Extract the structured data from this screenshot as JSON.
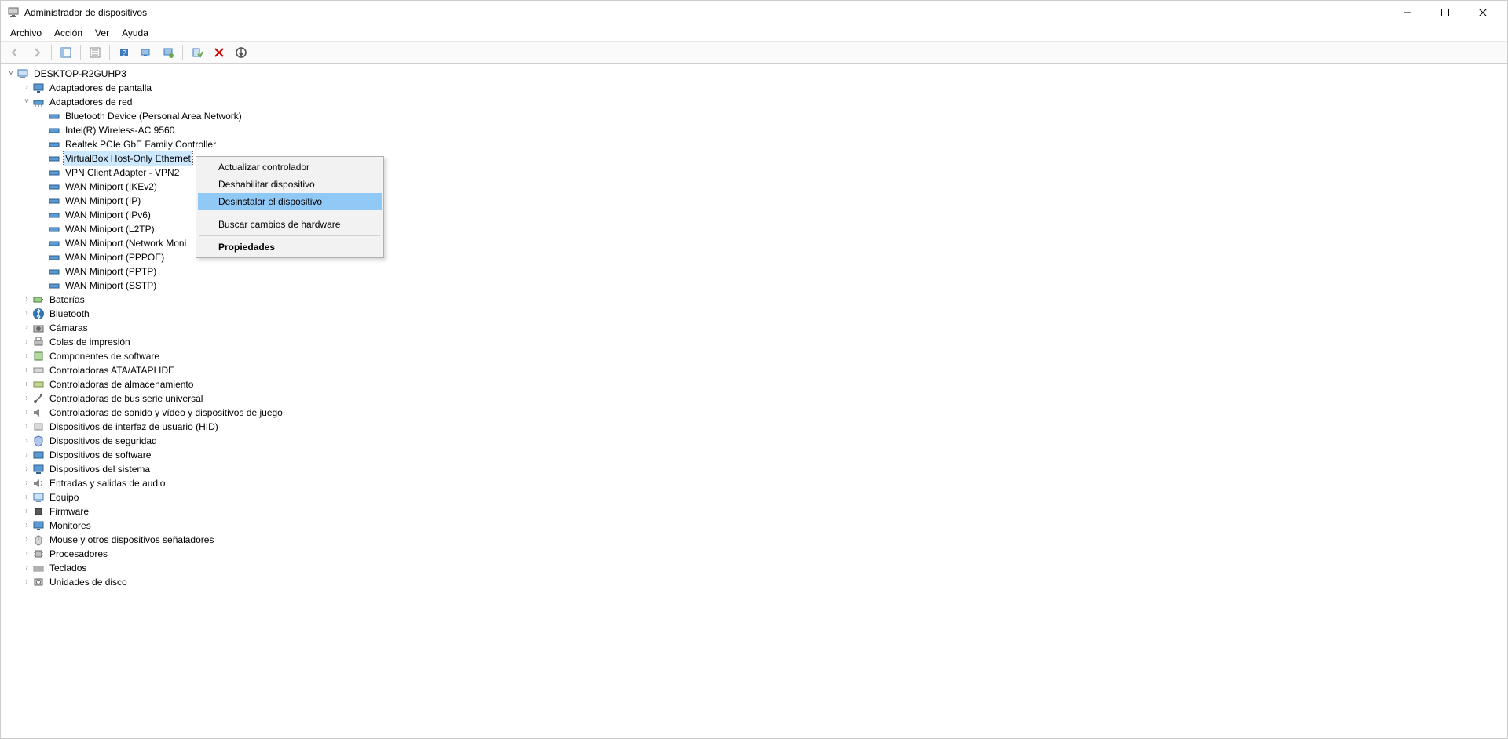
{
  "window": {
    "title": "Administrador de dispositivos"
  },
  "menu": {
    "file": "Archivo",
    "action": "Acción",
    "view": "Ver",
    "help": "Ayuda"
  },
  "tree": {
    "root": "DESKTOP-R2GUHP3",
    "display_adapters": "Adaptadores de pantalla",
    "network_adapters": "Adaptadores de red",
    "net": {
      "bluetooth_pan": "Bluetooth Device (Personal Area Network)",
      "intel_wireless": "Intel(R) Wireless-AC 9560",
      "realtek_gbe": "Realtek PCIe GbE Family Controller",
      "virtualbox": "VirtualBox Host-Only Ethernet",
      "vpn_client": "VPN Client Adapter - VPN2",
      "wan_ikev2": "WAN Miniport (IKEv2)",
      "wan_ip": "WAN Miniport (IP)",
      "wan_ipv6": "WAN Miniport (IPv6)",
      "wan_l2tp": "WAN Miniport (L2TP)",
      "wan_netmon": "WAN Miniport (Network Moni",
      "wan_pppoe": "WAN Miniport (PPPOE)",
      "wan_pptp": "WAN Miniport (PPTP)",
      "wan_sstp": "WAN Miniport (SSTP)"
    },
    "batteries": "Baterías",
    "bluetooth": "Bluetooth",
    "cameras": "Cámaras",
    "print_queues": "Colas de impresión",
    "software_components": "Componentes de software",
    "ata_controllers": "Controladoras ATA/ATAPI IDE",
    "storage_controllers": "Controladoras de almacenamiento",
    "usb_controllers": "Controladoras de bus serie universal",
    "audio_video_game": "Controladoras de sonido y vídeo y dispositivos de juego",
    "hid": "Dispositivos de interfaz de usuario (HID)",
    "security_devices": "Dispositivos de seguridad",
    "software_devices": "Dispositivos de software",
    "system_devices": "Dispositivos del sistema",
    "audio_io": "Entradas y salidas de audio",
    "computer": "Equipo",
    "firmware": "Firmware",
    "monitors": "Monitores",
    "mice": "Mouse y otros dispositivos señaladores",
    "processors": "Procesadores",
    "keyboards": "Teclados",
    "disk_drives": "Unidades de disco"
  },
  "context_menu": {
    "update_driver": "Actualizar controlador",
    "disable_device": "Deshabilitar dispositivo",
    "uninstall_device": "Desinstalar el dispositivo",
    "scan_hardware": "Buscar cambios de hardware",
    "properties": "Propiedades"
  }
}
